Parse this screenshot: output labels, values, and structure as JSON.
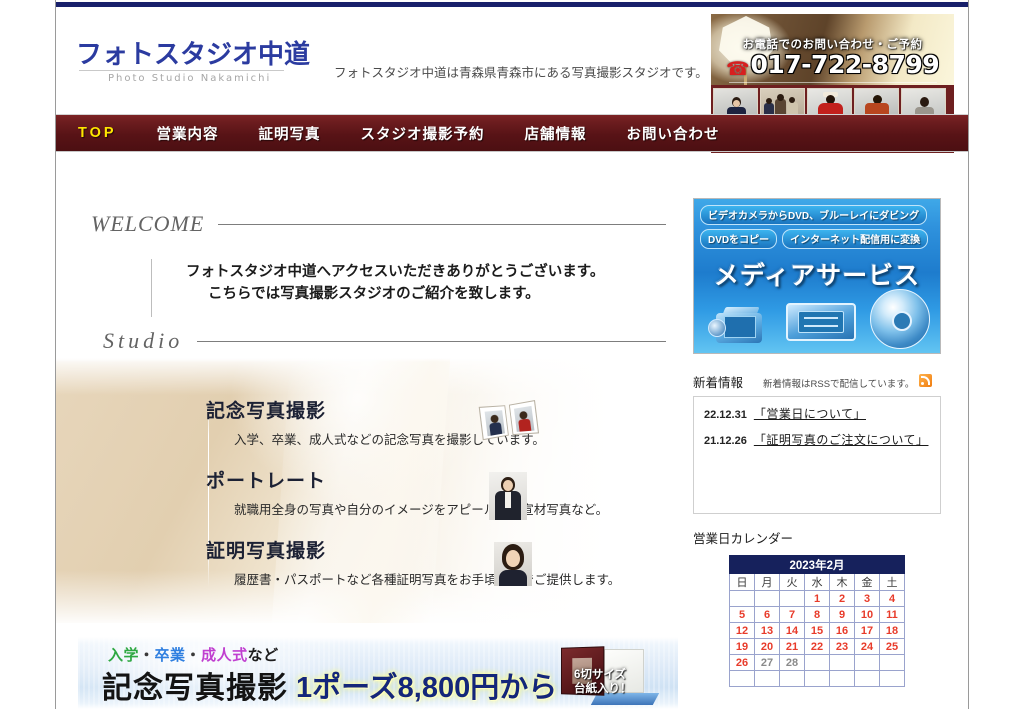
{
  "site": {
    "logo_main": "フォトスタジオ中道",
    "logo_sub": "Photo Studio Nakamichi",
    "tagline": "フォトスタジオ中道は青森県青森市にある写真撮影スタジオです。"
  },
  "contact": {
    "label": "お電話でのお問い合わせ・ご予約",
    "phone": "017-722-8799",
    "phone_icon": "telephone-receiver-icon"
  },
  "nav": {
    "items": [
      {
        "label": "TOP",
        "active": true
      },
      {
        "label": "営業内容",
        "active": false
      },
      {
        "label": "証明写真",
        "active": false
      },
      {
        "label": "スタジオ撮影予約",
        "active": false
      },
      {
        "label": "店舗情報",
        "active": false
      },
      {
        "label": "お問い合わせ",
        "active": false
      }
    ]
  },
  "welcome": {
    "heading": "WELCOME",
    "line1": "フォトスタジオ中道へアクセスいただきありがとうございます。",
    "line2": "こちらでは写真撮影スタジオのご紹介を致します。"
  },
  "studio": {
    "heading": "Studio",
    "services": [
      {
        "title": "記念写真撮影",
        "desc": "入学、卒業、成人式などの記念写真を撮影しています。",
        "icon": "photo-folder-icon"
      },
      {
        "title": "ポートレート",
        "desc": "就職用全身の写真や自分のイメージをアピールする宣材写真など。",
        "icon": "portrait-photo-icon"
      },
      {
        "title": "証明写真撮影",
        "desc": "履歴書・パスポートなど各種証明写真をお手頃価格でご提供します。",
        "icon": "id-photo-icon"
      }
    ]
  },
  "promo": {
    "occasion_1": "入学",
    "occasion_2": "卒業",
    "occasion_3": "成人式",
    "occasion_suffix": "など",
    "separator": "・",
    "title": "記念写真撮影",
    "price": "1ポーズ8,800円から",
    "badge_line1": "6切サイズ",
    "badge_line2": "台紙入り！",
    "colors": {
      "occasion_1": "#2ea842",
      "occasion_2": "#2f7fe0",
      "occasion_3": "#c03fd0",
      "price": "#14267a"
    }
  },
  "media_banner": {
    "pill_1": "ビデオカメラからDVD、ブルーレイにダビング",
    "pill_2": "DVDをコピー",
    "pill_3": "インターネット配信用に変換",
    "title": "メディアサービス",
    "icons": [
      "video-camera-icon",
      "vhs-tape-icon",
      "disc-icon"
    ],
    "accent_color": "#1e7ccd"
  },
  "news": {
    "title": "新着情報",
    "rss_note": "新着情報はRSSで配信しています。",
    "rss_icon": "rss-feed-icon",
    "items": [
      {
        "date": "22.12.31",
        "title": "「営業日について」"
      },
      {
        "date": "21.12.26",
        "title": "「証明写真のご注文について」"
      }
    ]
  },
  "calendar": {
    "section_title": "営業日カレンダー",
    "caption": "2023年2月",
    "weekdays": [
      "日",
      "月",
      "火",
      "水",
      "木",
      "金",
      "土"
    ],
    "open_color": "#e83b2a",
    "closed_color": "#8a8a8a",
    "weeks": [
      [
        {
          "day": "",
          "state": "empty"
        },
        {
          "day": "",
          "state": "empty"
        },
        {
          "day": "",
          "state": "empty"
        },
        {
          "day": "1",
          "state": "open"
        },
        {
          "day": "2",
          "state": "open"
        },
        {
          "day": "3",
          "state": "open"
        },
        {
          "day": "4",
          "state": "open"
        }
      ],
      [
        {
          "day": "5",
          "state": "open"
        },
        {
          "day": "6",
          "state": "open"
        },
        {
          "day": "7",
          "state": "open"
        },
        {
          "day": "8",
          "state": "open"
        },
        {
          "day": "9",
          "state": "open"
        },
        {
          "day": "10",
          "state": "open"
        },
        {
          "day": "11",
          "state": "open"
        }
      ],
      [
        {
          "day": "12",
          "state": "open"
        },
        {
          "day": "13",
          "state": "open"
        },
        {
          "day": "14",
          "state": "open"
        },
        {
          "day": "15",
          "state": "open"
        },
        {
          "day": "16",
          "state": "open"
        },
        {
          "day": "17",
          "state": "open"
        },
        {
          "day": "18",
          "state": "open"
        }
      ],
      [
        {
          "day": "19",
          "state": "open"
        },
        {
          "day": "20",
          "state": "open"
        },
        {
          "day": "21",
          "state": "open"
        },
        {
          "day": "22",
          "state": "open"
        },
        {
          "day": "23",
          "state": "open"
        },
        {
          "day": "24",
          "state": "open"
        },
        {
          "day": "25",
          "state": "open"
        }
      ],
      [
        {
          "day": "26",
          "state": "open"
        },
        {
          "day": "27",
          "state": "closed"
        },
        {
          "day": "28",
          "state": "closed"
        },
        {
          "day": "",
          "state": "empty"
        },
        {
          "day": "",
          "state": "empty"
        },
        {
          "day": "",
          "state": "empty"
        },
        {
          "day": "",
          "state": "empty"
        }
      ],
      [
        {
          "day": "",
          "state": "empty"
        },
        {
          "day": "",
          "state": "empty"
        },
        {
          "day": "",
          "state": "empty"
        },
        {
          "day": "",
          "state": "empty"
        },
        {
          "day": "",
          "state": "empty"
        },
        {
          "day": "",
          "state": "empty"
        },
        {
          "day": "",
          "state": "empty"
        }
      ]
    ]
  },
  "header_photos": [
    {
      "alt": "boy-in-navy-suit"
    },
    {
      "alt": "family-group-portrait"
    },
    {
      "alt": "woman-in-red-kimono"
    },
    {
      "alt": "woman-in-furisode"
    },
    {
      "alt": "boy-in-grey-suit"
    }
  ]
}
